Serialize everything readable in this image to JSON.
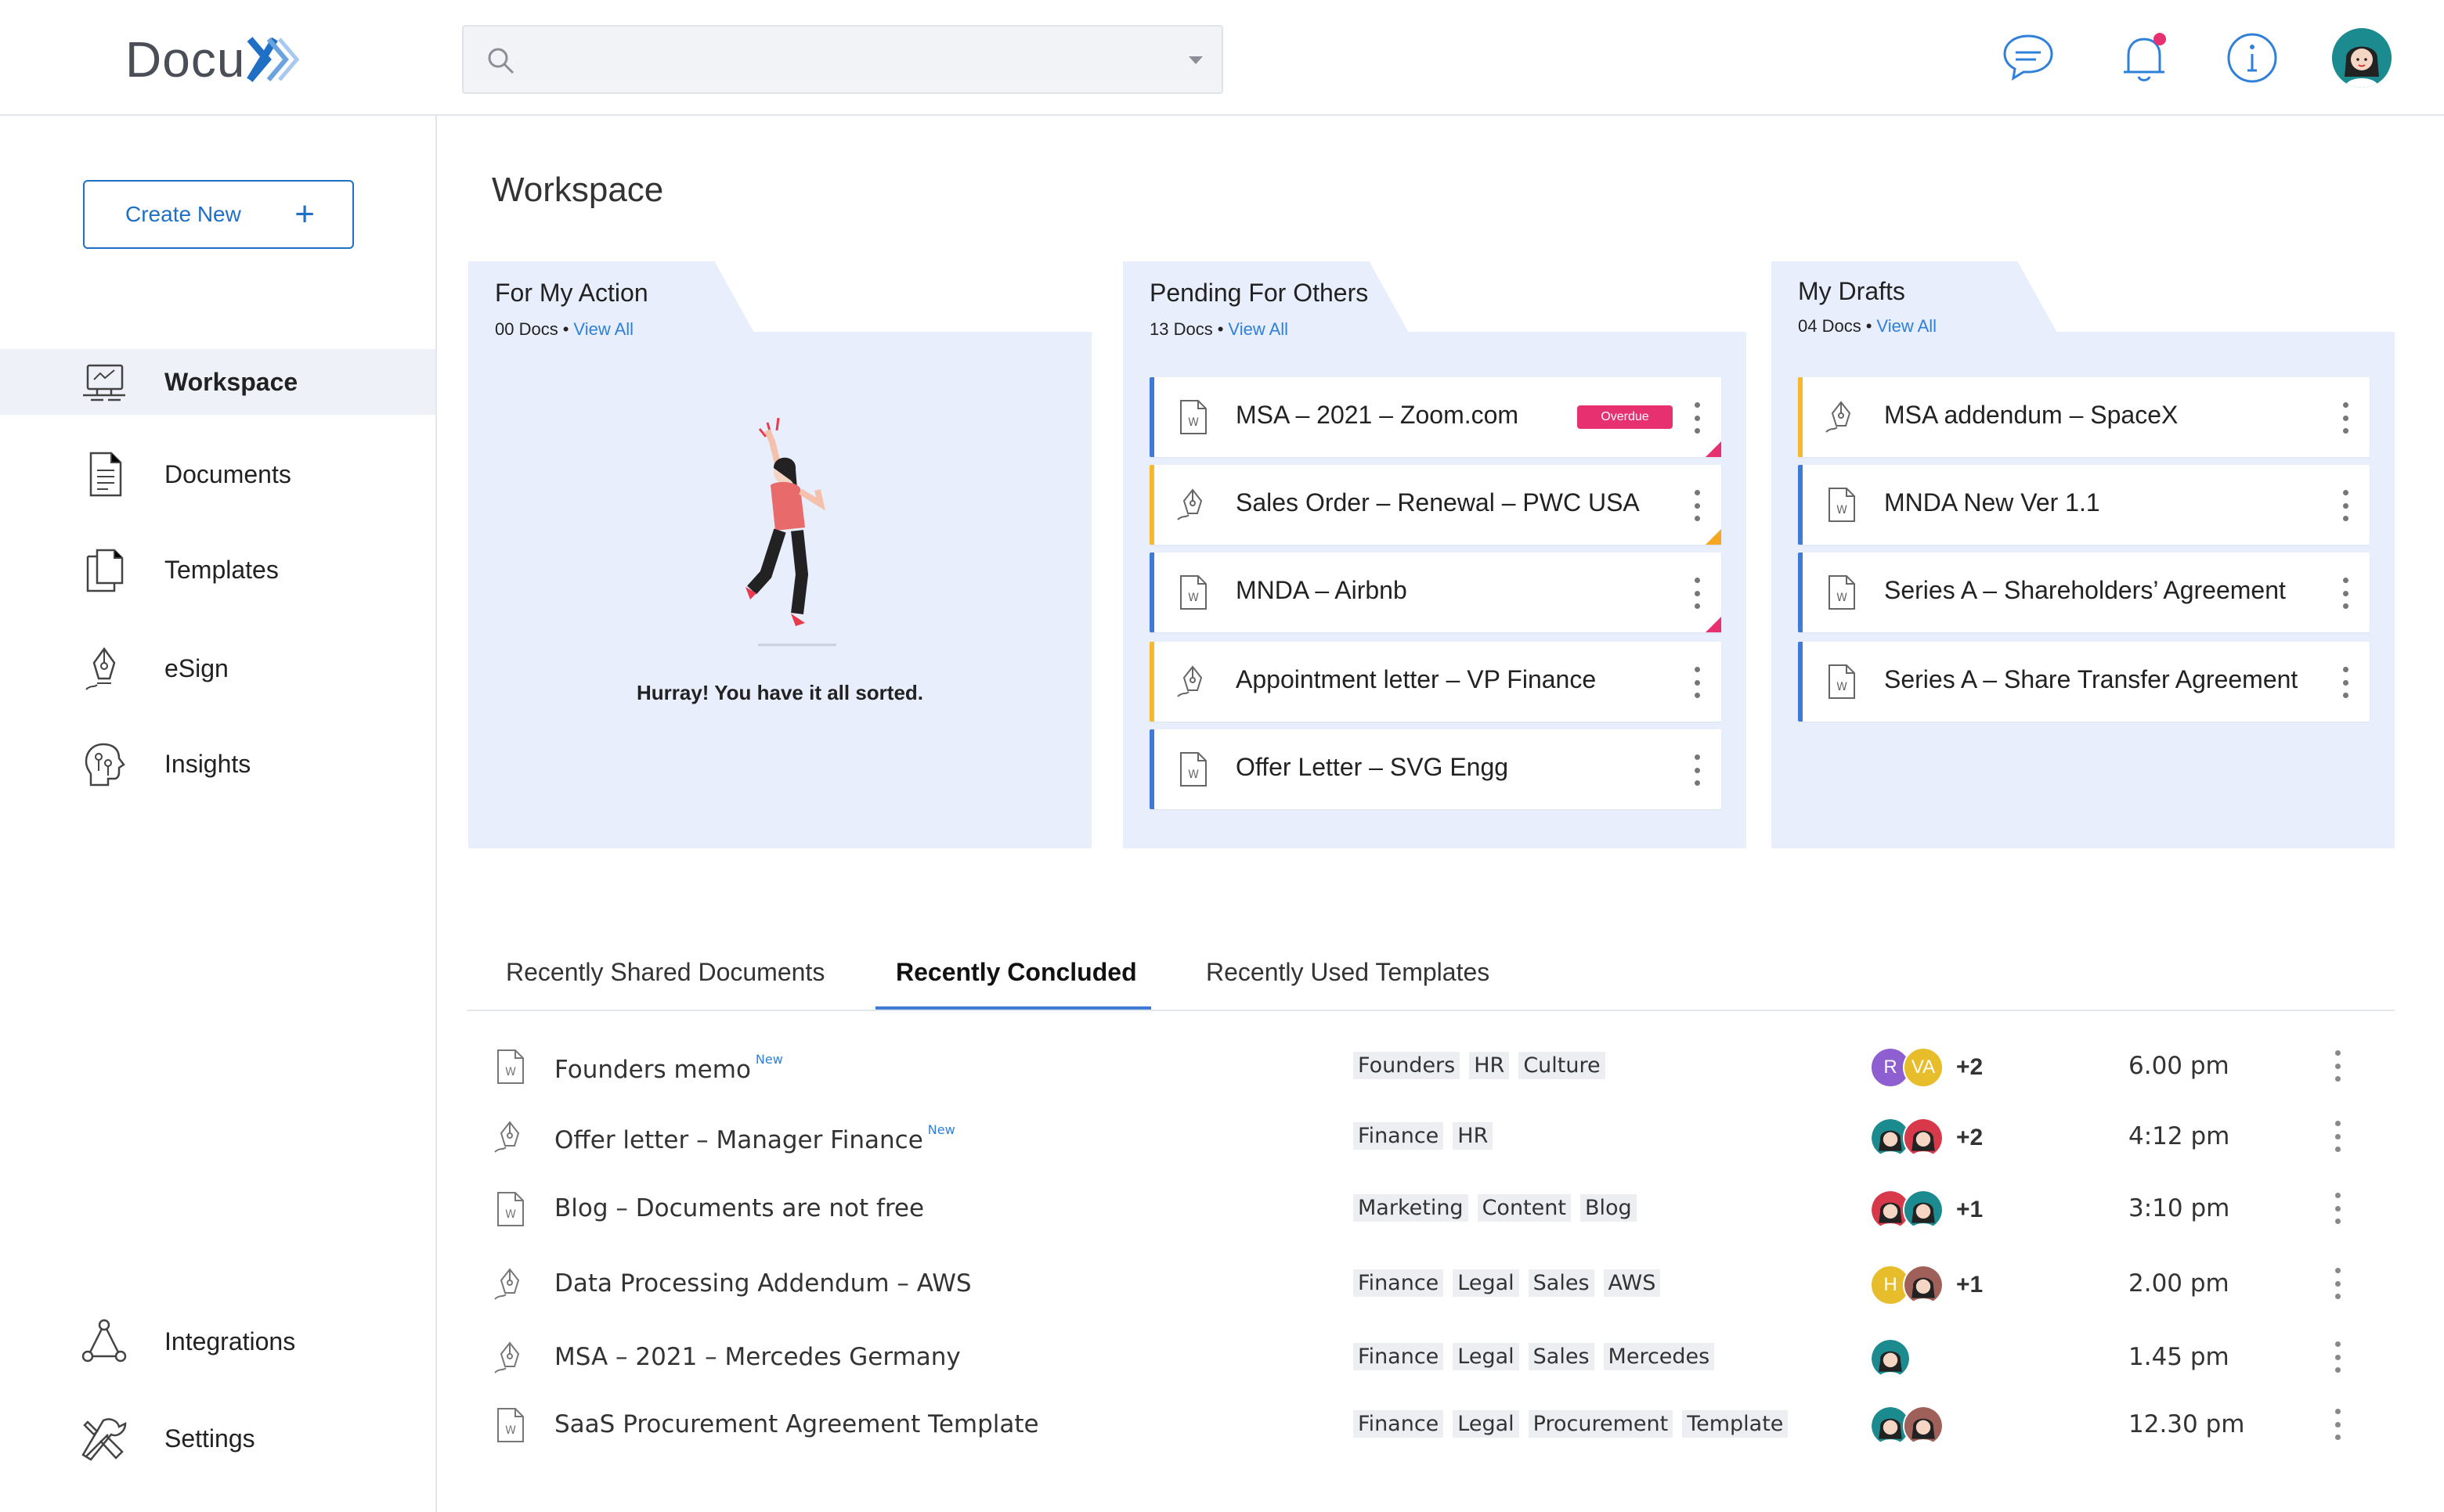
{
  "app": {
    "logo_text": "Docu",
    "accent_color": "#1f6fc5",
    "search": {
      "placeholder": "",
      "value": ""
    }
  },
  "topbar": {
    "icons": [
      "chat-icon",
      "bell-icon",
      "info-icon",
      "user-avatar"
    ]
  },
  "sidebar": {
    "create_label": "Create New",
    "items": [
      {
        "label": "Workspace",
        "icon": "workspace-icon",
        "active": true
      },
      {
        "label": "Documents",
        "icon": "documents-icon"
      },
      {
        "label": "Templates",
        "icon": "templates-icon"
      },
      {
        "label": "eSign",
        "icon": "esign-icon"
      },
      {
        "label": "Insights",
        "icon": "insights-icon"
      },
      {
        "label": "Integrations",
        "icon": "integrations-icon"
      },
      {
        "label": "Settings",
        "icon": "settings-icon"
      }
    ]
  },
  "main": {
    "title": "Workspace",
    "panels": [
      {
        "title": "For My Action",
        "count": "00 Docs",
        "view_all": "View All",
        "empty_message": "Hurray! You have it all sorted.",
        "docs": []
      },
      {
        "title": "Pending For Others",
        "count": "13 Docs",
        "view_all": "View All",
        "docs": [
          {
            "name": "MSA – 2021 – Zoom.com",
            "type": "word",
            "badge": "Overdue",
            "corner": "pink"
          },
          {
            "name": "Sales Order – Renewal – PWC USA",
            "type": "esign",
            "corner": "orange"
          },
          {
            "name": "MNDA – Airbnb",
            "type": "word",
            "corner": "pink"
          },
          {
            "name": "Appointment letter – VP Finance",
            "type": "esign"
          },
          {
            "name": "Offer Letter – SVG Engg",
            "type": "word"
          }
        ]
      },
      {
        "title": "My Drafts",
        "count": "04 Docs",
        "view_all": "View All",
        "docs": [
          {
            "name": "MSA addendum – SpaceX",
            "type": "esign"
          },
          {
            "name": "MNDA New Ver 1.1",
            "type": "word"
          },
          {
            "name": "Series A – Shareholders’ Agreement",
            "type": "word"
          },
          {
            "name": "Series A – Share Transfer Agreement",
            "type": "word"
          }
        ]
      }
    ],
    "tabs": [
      "Recently Shared Documents",
      "Recently Concluded",
      "Recently Used Templates"
    ],
    "active_tab": "Recently Concluded",
    "rows": [
      {
        "name": "Founders memo",
        "new": "New",
        "type": "word",
        "tags": [
          "Founders",
          "HR",
          "Culture"
        ],
        "avatars": [
          {
            "initials": "R",
            "color": "#8e5fd0"
          },
          {
            "initials": "VA",
            "color": "#e8bd2b"
          }
        ],
        "more": "+2",
        "time": "6.00 pm"
      },
      {
        "name": "Offer letter – Manager Finance",
        "new": "New",
        "type": "esign",
        "tags": [
          "Finance",
          "HR"
        ],
        "avatars": [
          {
            "initials": "",
            "color": "#1c8b8f"
          },
          {
            "initials": "",
            "color": "#d8394a"
          }
        ],
        "more": "+2",
        "time": "4:12 pm"
      },
      {
        "name": "Blog – Documents are not free",
        "new": "",
        "type": "word",
        "tags": [
          "Marketing",
          "Content",
          "Blog"
        ],
        "avatars": [
          {
            "initials": "",
            "color": "#d8394a"
          },
          {
            "initials": "",
            "color": "#1c8b8f"
          }
        ],
        "more": "+1",
        "time": "3:10 pm"
      },
      {
        "name": "Data Processing Addendum – AWS",
        "new": "",
        "type": "esign",
        "tags": [
          "Finance",
          "Legal",
          "Sales",
          "AWS"
        ],
        "avatars": [
          {
            "initials": "H",
            "color": "#e8bd2b"
          },
          {
            "initials": "",
            "color": "#a0605a"
          }
        ],
        "more": "+1",
        "time": "2.00 pm"
      },
      {
        "name": "MSA – 2021 – Mercedes Germany",
        "new": "",
        "type": "esign",
        "tags": [
          "Finance",
          "Legal",
          "Sales",
          "Mercedes"
        ],
        "avatars": [
          {
            "initials": "",
            "color": "#1c8b8f"
          }
        ],
        "more": "",
        "time": "1.45 pm"
      },
      {
        "name": "SaaS Procurement Agreement Template",
        "new": "",
        "type": "word",
        "tags": [
          "Finance",
          "Legal",
          "Procurement",
          "Template"
        ],
        "avatars": [
          {
            "initials": "",
            "color": "#1c8b8f"
          },
          {
            "initials": "",
            "color": "#a0605a"
          }
        ],
        "more": "",
        "time": "12.30 pm"
      }
    ]
  }
}
